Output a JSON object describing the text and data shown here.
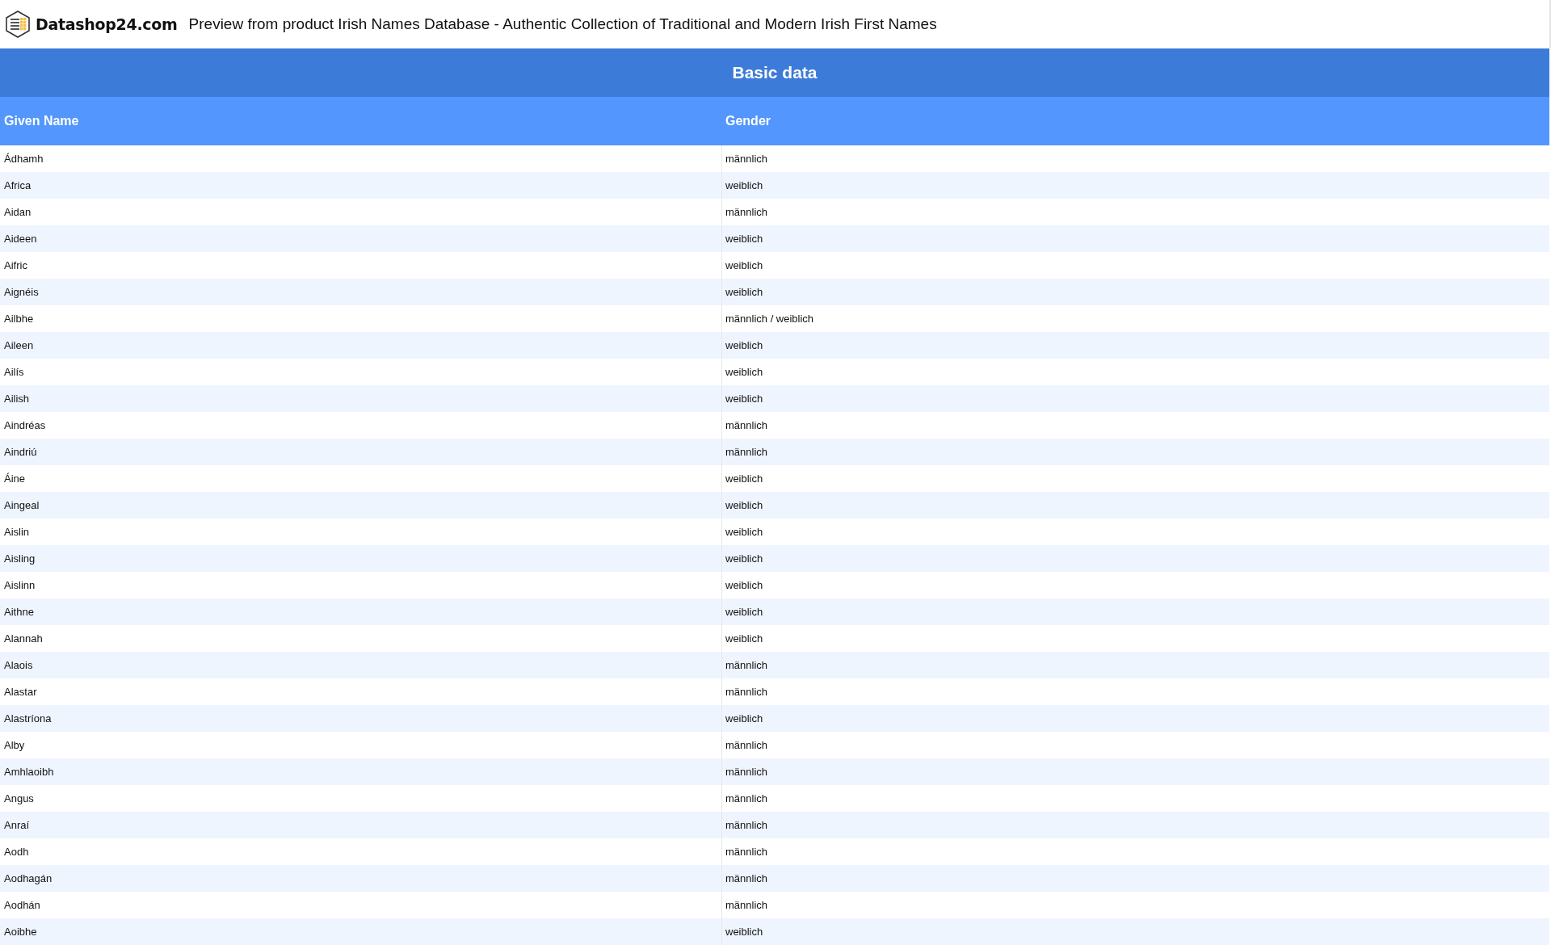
{
  "header": {
    "brand": "Datashop24.com",
    "title": "Preview from product Irish Names Database - Authentic Collection of Traditional and Modern Irish First Names"
  },
  "table": {
    "section_title": "Basic data",
    "columns": [
      "Given Name",
      "Gender"
    ],
    "rows": [
      [
        "Ádhamh",
        "männlich"
      ],
      [
        "Africa",
        "weiblich"
      ],
      [
        "Aidan",
        "männlich"
      ],
      [
        "Aideen",
        "weiblich"
      ],
      [
        "Aifric",
        "weiblich"
      ],
      [
        "Aignéis",
        "weiblich"
      ],
      [
        "Ailbhe",
        "männlich / weiblich"
      ],
      [
        "Aileen",
        "weiblich"
      ],
      [
        "Ailís",
        "weiblich"
      ],
      [
        "Ailish",
        "weiblich"
      ],
      [
        "Aindréas",
        "männlich"
      ],
      [
        "Aindriú",
        "männlich"
      ],
      [
        "Áine",
        "weiblich"
      ],
      [
        "Aingeal",
        "weiblich"
      ],
      [
        "Aislin",
        "weiblich"
      ],
      [
        "Aisling",
        "weiblich"
      ],
      [
        "Aislinn",
        "weiblich"
      ],
      [
        "Aithne",
        "weiblich"
      ],
      [
        "Alannah",
        "weiblich"
      ],
      [
        "Alaois",
        "männlich"
      ],
      [
        "Alastar",
        "männlich"
      ],
      [
        "Alastríona",
        "weiblich"
      ],
      [
        "Alby",
        "männlich"
      ],
      [
        "Amhlaoibh",
        "männlich"
      ],
      [
        "Angus",
        "männlich"
      ],
      [
        "Anraí",
        "männlich"
      ],
      [
        "Aodh",
        "männlich"
      ],
      [
        "Aodhagán",
        "männlich"
      ],
      [
        "Aodhán",
        "männlich"
      ],
      [
        "Aoibhe",
        "weiblich"
      ]
    ]
  }
}
